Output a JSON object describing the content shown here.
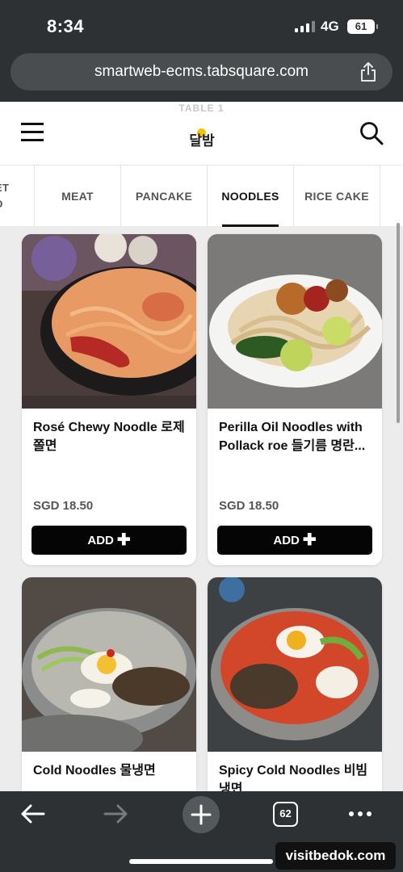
{
  "status_bar": {
    "time": "8:34",
    "network": "4G",
    "battery": "61"
  },
  "browser": {
    "url": "smartweb-ecms.tabsquare.com",
    "tab_count": "62"
  },
  "header": {
    "table_label": "TABLE 1",
    "logo_text": "달밤"
  },
  "categories": {
    "partial_label_line1": "ET",
    "partial_label_line2": "D",
    "tabs": [
      {
        "label": "MEAT"
      },
      {
        "label": "PANCAKE"
      },
      {
        "label": "NOODLES"
      },
      {
        "label": "RICE CAKE"
      }
    ],
    "active": "NOODLES"
  },
  "menu": {
    "add_label": "ADD",
    "items": [
      {
        "name": "Rosé Chewy Noodle 로제 쫄면",
        "price": "SGD 18.50"
      },
      {
        "name": "Perilla Oil Noodles with Pollack roe 들기름 명란...",
        "price": "SGD 18.50"
      },
      {
        "name": "Cold Noodles 물냉면",
        "price": ""
      },
      {
        "name": "Spicy Cold Noodles 비빔냉면",
        "price": ""
      }
    ]
  },
  "watermark": "visitbedok.com",
  "colors": {
    "add_button": "#050505",
    "page_bg": "#ececec",
    "browser_chrome": "#2d3133"
  },
  "icons": [
    "hamburger-menu-icon",
    "search-icon",
    "share-icon",
    "back-arrow-icon",
    "forward-arrow-icon",
    "plus-icon",
    "more-dots-icon"
  ]
}
